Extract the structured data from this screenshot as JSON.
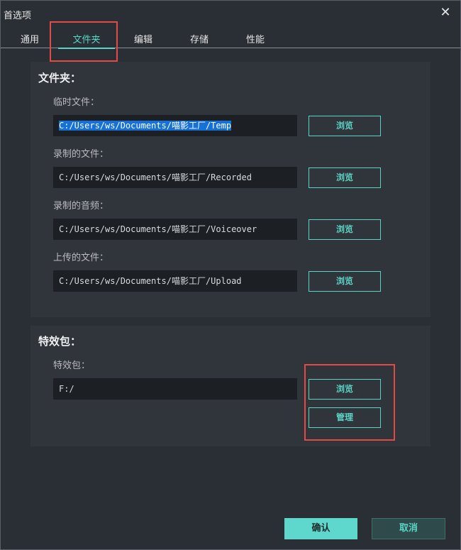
{
  "window": {
    "title": "首选项",
    "close_glyph": "✕"
  },
  "tabs": [
    {
      "label": "通用",
      "active": false
    },
    {
      "label": "文件夹",
      "active": true
    },
    {
      "label": "编辑",
      "active": false
    },
    {
      "label": "存储",
      "active": false
    },
    {
      "label": "性能",
      "active": false
    }
  ],
  "folders": {
    "title": "文件夹：",
    "rows": [
      {
        "label": "临时文件：",
        "path": "C:/Users/ws/Documents/喵影工厂/Temp",
        "selected": true,
        "button": "浏览"
      },
      {
        "label": "录制的文件：",
        "path": "C:/Users/ws/Documents/喵影工厂/Recorded",
        "selected": false,
        "button": "浏览"
      },
      {
        "label": "录制的音频：",
        "path": "C:/Users/ws/Documents/喵影工厂/Voiceover",
        "selected": false,
        "button": "浏览"
      },
      {
        "label": "上传的文件：",
        "path": "C:/Users/ws/Documents/喵影工厂/Upload",
        "selected": false,
        "button": "浏览"
      }
    ]
  },
  "effects": {
    "title": "特效包：",
    "label": "特效包：",
    "path": "F:/",
    "browse_button": "浏览",
    "manage_button": "管理"
  },
  "footer": {
    "confirm": "确认",
    "cancel": "取消"
  },
  "colors": {
    "accent": "#5ad4c6",
    "annotation": "#e24a46",
    "selection": "#1570d8"
  }
}
